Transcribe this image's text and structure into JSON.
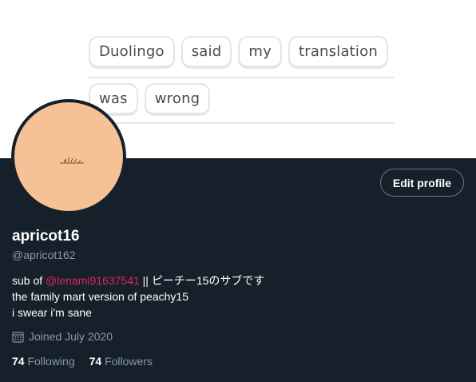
{
  "banner": {
    "row1": [
      "Duolingo",
      "said",
      "my",
      "translation"
    ],
    "row2": [
      "was",
      "wrong"
    ]
  },
  "profile": {
    "edit_label": "Edit profile",
    "display_name": "apricot16",
    "handle": "@apricot162",
    "bio": {
      "line1_prefix": "sub of ",
      "line1_mention": "@lenami91637541",
      "line1_suffix": " || ピーチー15のサブです",
      "line2": "the family mart version of peachy15",
      "line3": "i swear i'm sane"
    },
    "joined": "Joined July 2020",
    "joined_icon": "calendar-icon",
    "following_count": "74",
    "following_label": "Following",
    "followers_count": "74",
    "followers_label": "Followers"
  },
  "colors": {
    "profile_bg": "#15202b",
    "avatar_bg": "#f5c195",
    "mention": "#e0245e",
    "muted": "#8899a6"
  }
}
